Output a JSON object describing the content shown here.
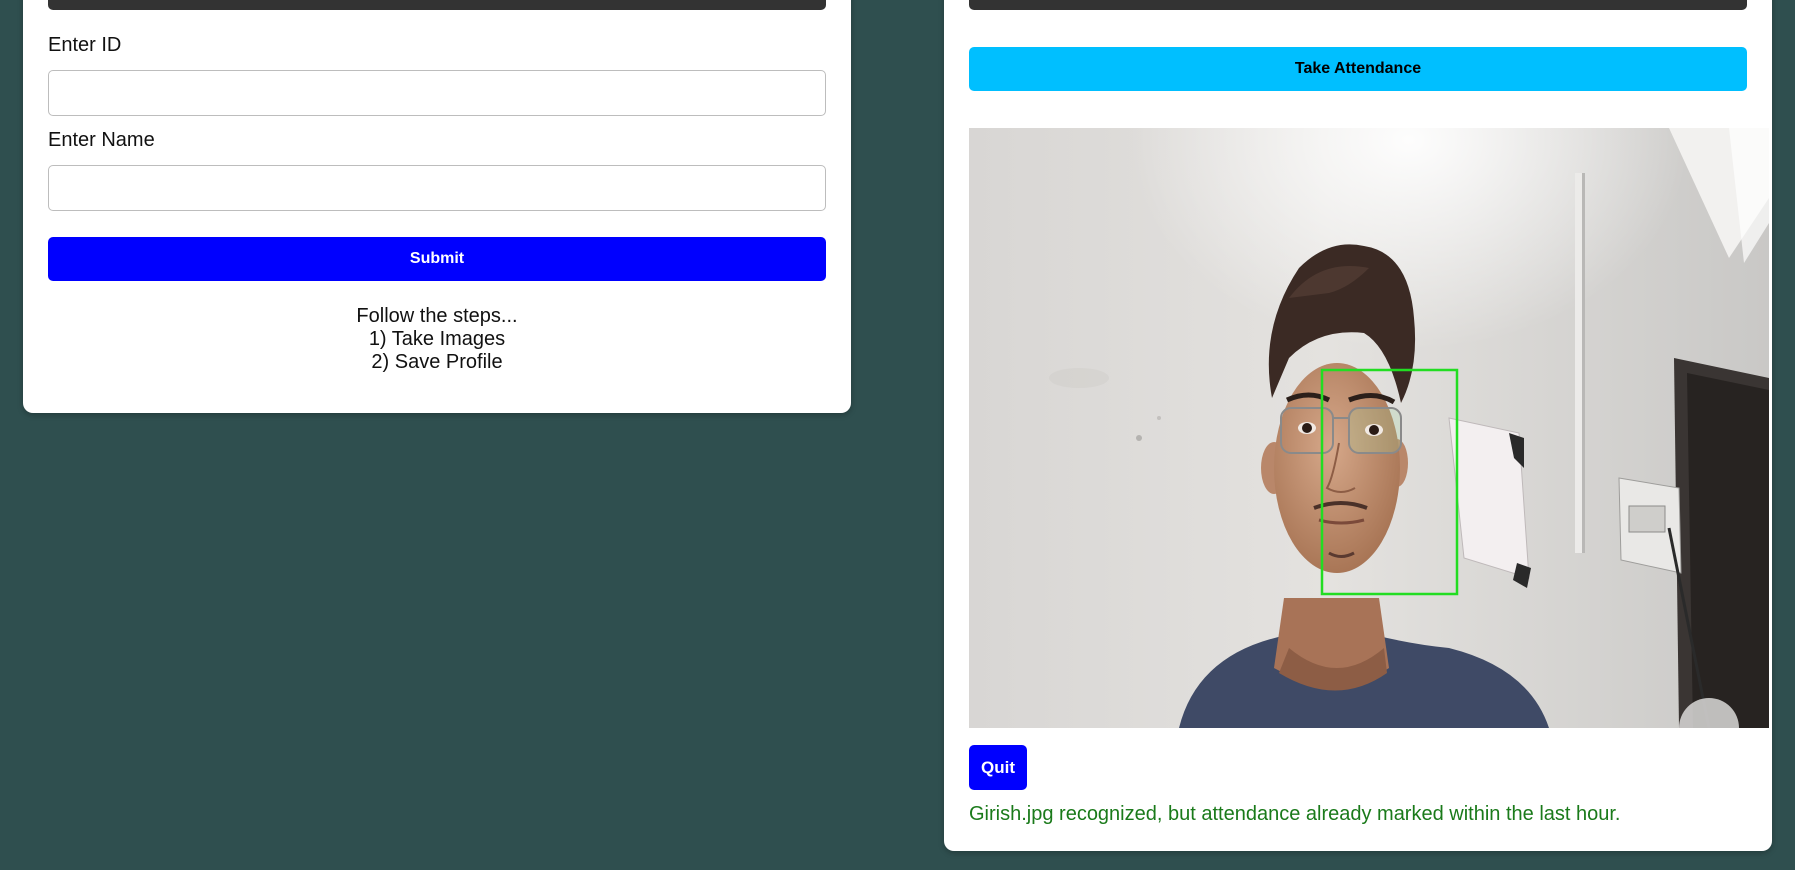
{
  "register_form": {
    "id_label": "Enter ID",
    "id_value": "",
    "name_label": "Enter Name",
    "name_value": "",
    "submit_label": "Submit",
    "steps": [
      "Follow the steps...",
      "1) Take Images",
      "2) Save Profile"
    ]
  },
  "attendance": {
    "take_attendance_label": "Take Attendance",
    "camera_icon": "camera-feed-image",
    "face_box_color": "#22dd22",
    "quit_label": "Quit",
    "status_message": "Girish.jpg recognized, but attendance already marked within the last hour.",
    "status_color": "#1a7a1a"
  },
  "colors": {
    "background": "#2f4f4f",
    "submit": "#0000ff",
    "take_attendance": "#00bfff",
    "quit": "#0000ff"
  }
}
